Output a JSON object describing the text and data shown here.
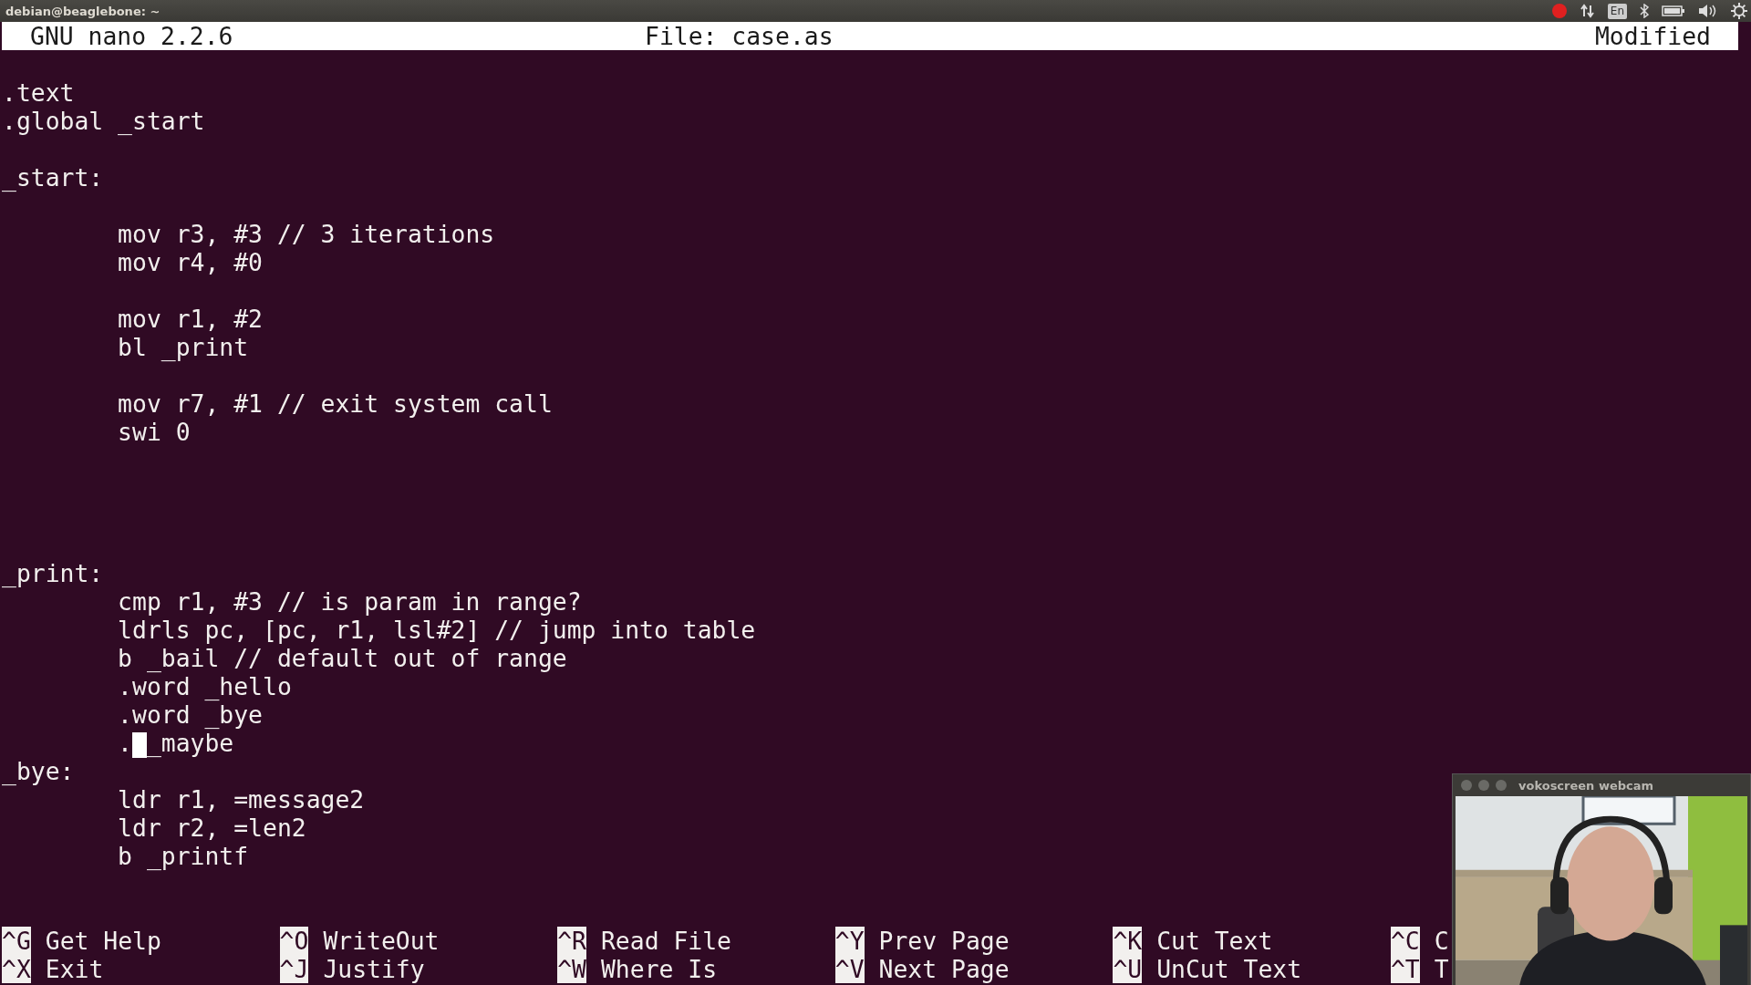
{
  "top_panel": {
    "title": "debian@beaglebone: ~",
    "keyboard_layout": "En"
  },
  "nano": {
    "version": "GNU nano 2.2.6",
    "file": "File: case.as",
    "status": "Modified"
  },
  "lines": [
    {
      "kind": "blank"
    },
    {
      "kind": "code",
      "text": ".text"
    },
    {
      "kind": "code",
      "text": ".global _start"
    },
    {
      "kind": "blank"
    },
    {
      "kind": "code",
      "text": "_start:"
    },
    {
      "kind": "blank"
    },
    {
      "kind": "code",
      "text": "\tmov r3, #3 // 3 iterations"
    },
    {
      "kind": "code",
      "text": "\tmov r4, #0"
    },
    {
      "kind": "blank"
    },
    {
      "kind": "code",
      "text": "\tmov r1, #2"
    },
    {
      "kind": "code",
      "text": "\tbl _print"
    },
    {
      "kind": "blank"
    },
    {
      "kind": "code",
      "text": "\tmov r7, #1 // exit system call"
    },
    {
      "kind": "code",
      "text": "\tswi 0"
    },
    {
      "kind": "blank"
    },
    {
      "kind": "blank"
    },
    {
      "kind": "blank"
    },
    {
      "kind": "blank"
    },
    {
      "kind": "code",
      "text": "_print:"
    },
    {
      "kind": "code",
      "text": "\tcmp r1, #3 // is param in range?"
    },
    {
      "kind": "code",
      "text": "\tldrls pc, [pc, r1, lsl#2] // jump into table"
    },
    {
      "kind": "code",
      "text": "\tb _bail // default out of range"
    },
    {
      "kind": "code",
      "text": "\t.word _hello"
    },
    {
      "kind": "code",
      "text": "\t.word _bye"
    },
    {
      "kind": "cursor",
      "before": "\t.",
      "after": "_maybe"
    },
    {
      "kind": "code",
      "text": "_bye:"
    },
    {
      "kind": "code",
      "text": "\tldr r1, =message2"
    },
    {
      "kind": "code",
      "text": "\tldr r2, =len2"
    },
    {
      "kind": "code",
      "text": "\tb _printf"
    },
    {
      "kind": "blank"
    },
    {
      "kind": "blank"
    }
  ],
  "shortcut_rows": [
    [
      {
        "key": "^G",
        "label": "Get Help"
      },
      {
        "key": "^O",
        "label": "WriteOut"
      },
      {
        "key": "^R",
        "label": "Read File"
      },
      {
        "key": "^Y",
        "label": "Prev Page"
      },
      {
        "key": "^K",
        "label": "Cut Text"
      },
      {
        "key": "^C",
        "label": "C"
      }
    ],
    [
      {
        "key": "^X",
        "label": "Exit"
      },
      {
        "key": "^J",
        "label": "Justify"
      },
      {
        "key": "^W",
        "label": "Where Is"
      },
      {
        "key": "^V",
        "label": "Next Page"
      },
      {
        "key": "^U",
        "label": "UnCut Text"
      },
      {
        "key": "^T",
        "label": "T"
      }
    ]
  ],
  "webcam": {
    "title": "vokoscreen webcam"
  }
}
